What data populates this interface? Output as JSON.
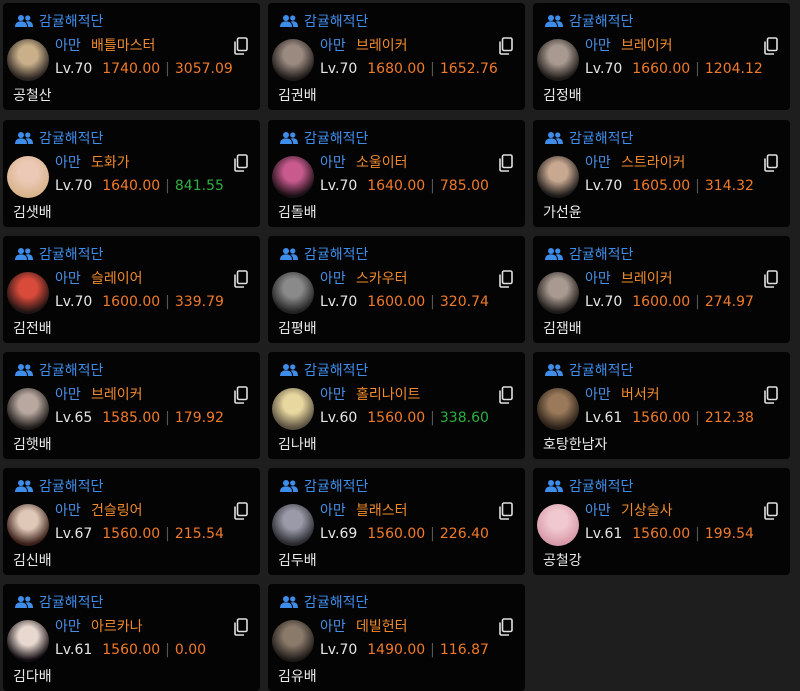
{
  "cards": [
    {
      "guild": "감귤해적단",
      "server": "아만",
      "class": "배틀마스터",
      "level": "Lv.70",
      "item_level": "1740.00",
      "combat_power": "3057.09",
      "name": "공철산",
      "cp_color": "#f07a2a",
      "avatar_colors": [
        "#c9b08a",
        "#2a2320"
      ]
    },
    {
      "guild": "감귤해적단",
      "server": "아만",
      "class": "브레이커",
      "level": "Lv.70",
      "item_level": "1680.00",
      "combat_power": "1652.76",
      "name": "김권배",
      "cp_color": "#f07a2a",
      "avatar_colors": [
        "#9a8a80",
        "#1e1a18"
      ]
    },
    {
      "guild": "감귤해적단",
      "server": "아만",
      "class": "브레이커",
      "level": "Lv.70",
      "item_level": "1660.00",
      "combat_power": "1204.12",
      "name": "김정배",
      "cp_color": "#f07a2a",
      "avatar_colors": [
        "#a89a90",
        "#1e1a18"
      ]
    },
    {
      "guild": "감귤해적단",
      "server": "아만",
      "class": "도화가",
      "level": "Lv.70",
      "item_level": "1640.00",
      "combat_power": "841.55",
      "name": "김샛배",
      "cp_color": "#2db042",
      "avatar_colors": [
        "#ecc9b6",
        "#d8b48c"
      ]
    },
    {
      "guild": "감귤해적단",
      "server": "아만",
      "class": "소울이터",
      "level": "Lv.70",
      "item_level": "1640.00",
      "combat_power": "785.00",
      "name": "김돌배",
      "cp_color": "#f07a2a",
      "avatar_colors": [
        "#c85a8e",
        "#1a0f14"
      ]
    },
    {
      "guild": "감귤해적단",
      "server": "아만",
      "class": "스트라이커",
      "level": "Lv.70",
      "item_level": "1605.00",
      "combat_power": "314.32",
      "name": "가선윤",
      "cp_color": "#f07a2a",
      "avatar_colors": [
        "#c8a890",
        "#1c1a1a"
      ]
    },
    {
      "guild": "감귤해적단",
      "server": "아만",
      "class": "슬레이어",
      "level": "Lv.70",
      "item_level": "1600.00",
      "combat_power": "339.79",
      "name": "김전배",
      "cp_color": "#f07a2a",
      "avatar_colors": [
        "#d84a3a",
        "#201414"
      ]
    },
    {
      "guild": "감귤해적단",
      "server": "아만",
      "class": "스카우터",
      "level": "Lv.70",
      "item_level": "1600.00",
      "combat_power": "320.74",
      "name": "김평배",
      "cp_color": "#f07a2a",
      "avatar_colors": [
        "#8a8a8a",
        "#222222"
      ]
    },
    {
      "guild": "감귤해적단",
      "server": "아만",
      "class": "브레이커",
      "level": "Lv.70",
      "item_level": "1600.00",
      "combat_power": "274.97",
      "name": "김잼배",
      "cp_color": "#f07a2a",
      "avatar_colors": [
        "#a89a90",
        "#1e1a18"
      ]
    },
    {
      "guild": "감귤해적단",
      "server": "아만",
      "class": "브레이커",
      "level": "Lv.65",
      "item_level": "1585.00",
      "combat_power": "179.92",
      "name": "김햇배",
      "cp_color": "#f07a2a",
      "avatar_colors": [
        "#b8a8a0",
        "#1e1a18"
      ]
    },
    {
      "guild": "감귤해적단",
      "server": "아만",
      "class": "홀리나이트",
      "level": "Lv.60",
      "item_level": "1560.00",
      "combat_power": "338.60",
      "name": "김나배",
      "cp_color": "#2db042",
      "avatar_colors": [
        "#e8d8a0",
        "#5a5040"
      ]
    },
    {
      "guild": "감귤해적단",
      "server": "아만",
      "class": "버서커",
      "level": "Lv.61",
      "item_level": "1560.00",
      "combat_power": "212.38",
      "name": "호탕한남자",
      "cp_color": "#f07a2a",
      "avatar_colors": [
        "#9a7a5a",
        "#2a2018"
      ]
    },
    {
      "guild": "감귤해적단",
      "server": "아만",
      "class": "건슬링어",
      "level": "Lv.67",
      "item_level": "1560.00",
      "combat_power": "215.54",
      "name": "김신배",
      "cp_color": "#f07a2a",
      "avatar_colors": [
        "#e0c8b8",
        "#3a2018"
      ]
    },
    {
      "guild": "감귤해적단",
      "server": "아만",
      "class": "블래스터",
      "level": "Lv.69",
      "item_level": "1560.00",
      "combat_power": "226.40",
      "name": "김두배",
      "cp_color": "#f07a2a",
      "avatar_colors": [
        "#9a9aa8",
        "#2a2a30"
      ]
    },
    {
      "guild": "감귤해적단",
      "server": "아만",
      "class": "기상술사",
      "level": "Lv.61",
      "item_level": "1560.00",
      "combat_power": "199.54",
      "name": "공철강",
      "cp_color": "#f07a2a",
      "avatar_colors": [
        "#f0c8d0",
        "#d89aa8"
      ]
    },
    {
      "guild": "감귤해적단",
      "server": "아만",
      "class": "아르카나",
      "level": "Lv.61",
      "item_level": "1560.00",
      "combat_power": "0.00",
      "name": "김다배",
      "cp_color": "#f07a2a",
      "avatar_colors": [
        "#e8d8d0",
        "#120c10"
      ]
    },
    {
      "guild": "감귤해적단",
      "server": "아만",
      "class": "데빌헌터",
      "level": "Lv.70",
      "item_level": "1490.00",
      "combat_power": "116.87",
      "name": "김유배",
      "cp_color": "#f07a2a",
      "avatar_colors": [
        "#8a7a6a",
        "#1e1a18"
      ]
    }
  ],
  "icons": {
    "guild": "group-icon",
    "copy": "copy-icon"
  },
  "colors": {
    "guild": "#3f8dea",
    "server": "#4a8fe6",
    "class": "#f08a2c",
    "item_level": "#f07a2a",
    "positive": "#2db042"
  }
}
